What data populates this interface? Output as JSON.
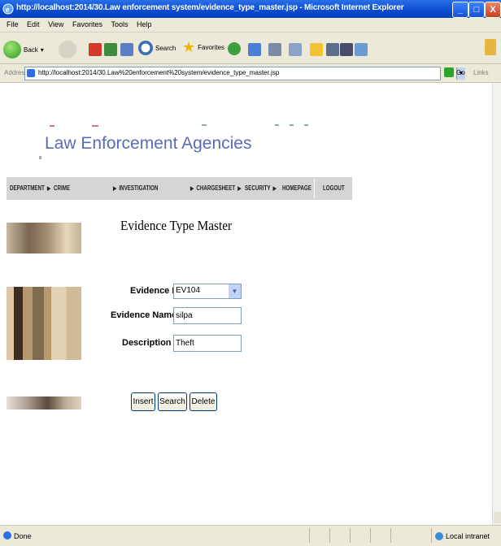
{
  "window": {
    "title": "http://localhost:2014/30.Law enforcement system/evidence_type_master.jsp - Microsoft Internet Explorer",
    "minimize": "_",
    "maximize": "□",
    "close": "X"
  },
  "menu": [
    "File",
    "Edit",
    "View",
    "Favorites",
    "Tools",
    "Help"
  ],
  "toolbar": {
    "back": "Back",
    "search": "Search",
    "favorites": "Favorites"
  },
  "address": {
    "label": "Address",
    "url": "http://localhost:2014/30.Law%20enforcement%20system/evidence_type_master.jsp",
    "go": "Go",
    "links": "Links"
  },
  "banner": {
    "title": "Law Enforcement Agencies"
  },
  "nav": {
    "items": [
      {
        "label": "DEPARTMENT",
        "arrow": "▶"
      },
      {
        "label": "CRIME",
        "arrow": ""
      },
      {
        "label": "INVESTIGATION",
        "arrow": "▶"
      },
      {
        "label": "CHARGESHEET",
        "arrow": "▶"
      },
      {
        "label": "SECURITY",
        "arrow": "▶"
      },
      {
        "label": "HOMEPAGE",
        "arrow": ""
      },
      {
        "label": "LOGOUT",
        "arrow": ""
      }
    ],
    "crime_arrow": "▶"
  },
  "page": {
    "title": "Evidence Type Master"
  },
  "form": {
    "evidence_id_label": "Evidence ID",
    "evidence_id_value": "EV104",
    "evidence_name_label": "Evidence Name",
    "evidence_name_value": "silpa",
    "description_label": "Description",
    "description_value": "Theft",
    "insert": "Insert",
    "search": "Search",
    "delete": "Delete"
  },
  "status": {
    "text": "Done",
    "zone": "Local intranet"
  }
}
